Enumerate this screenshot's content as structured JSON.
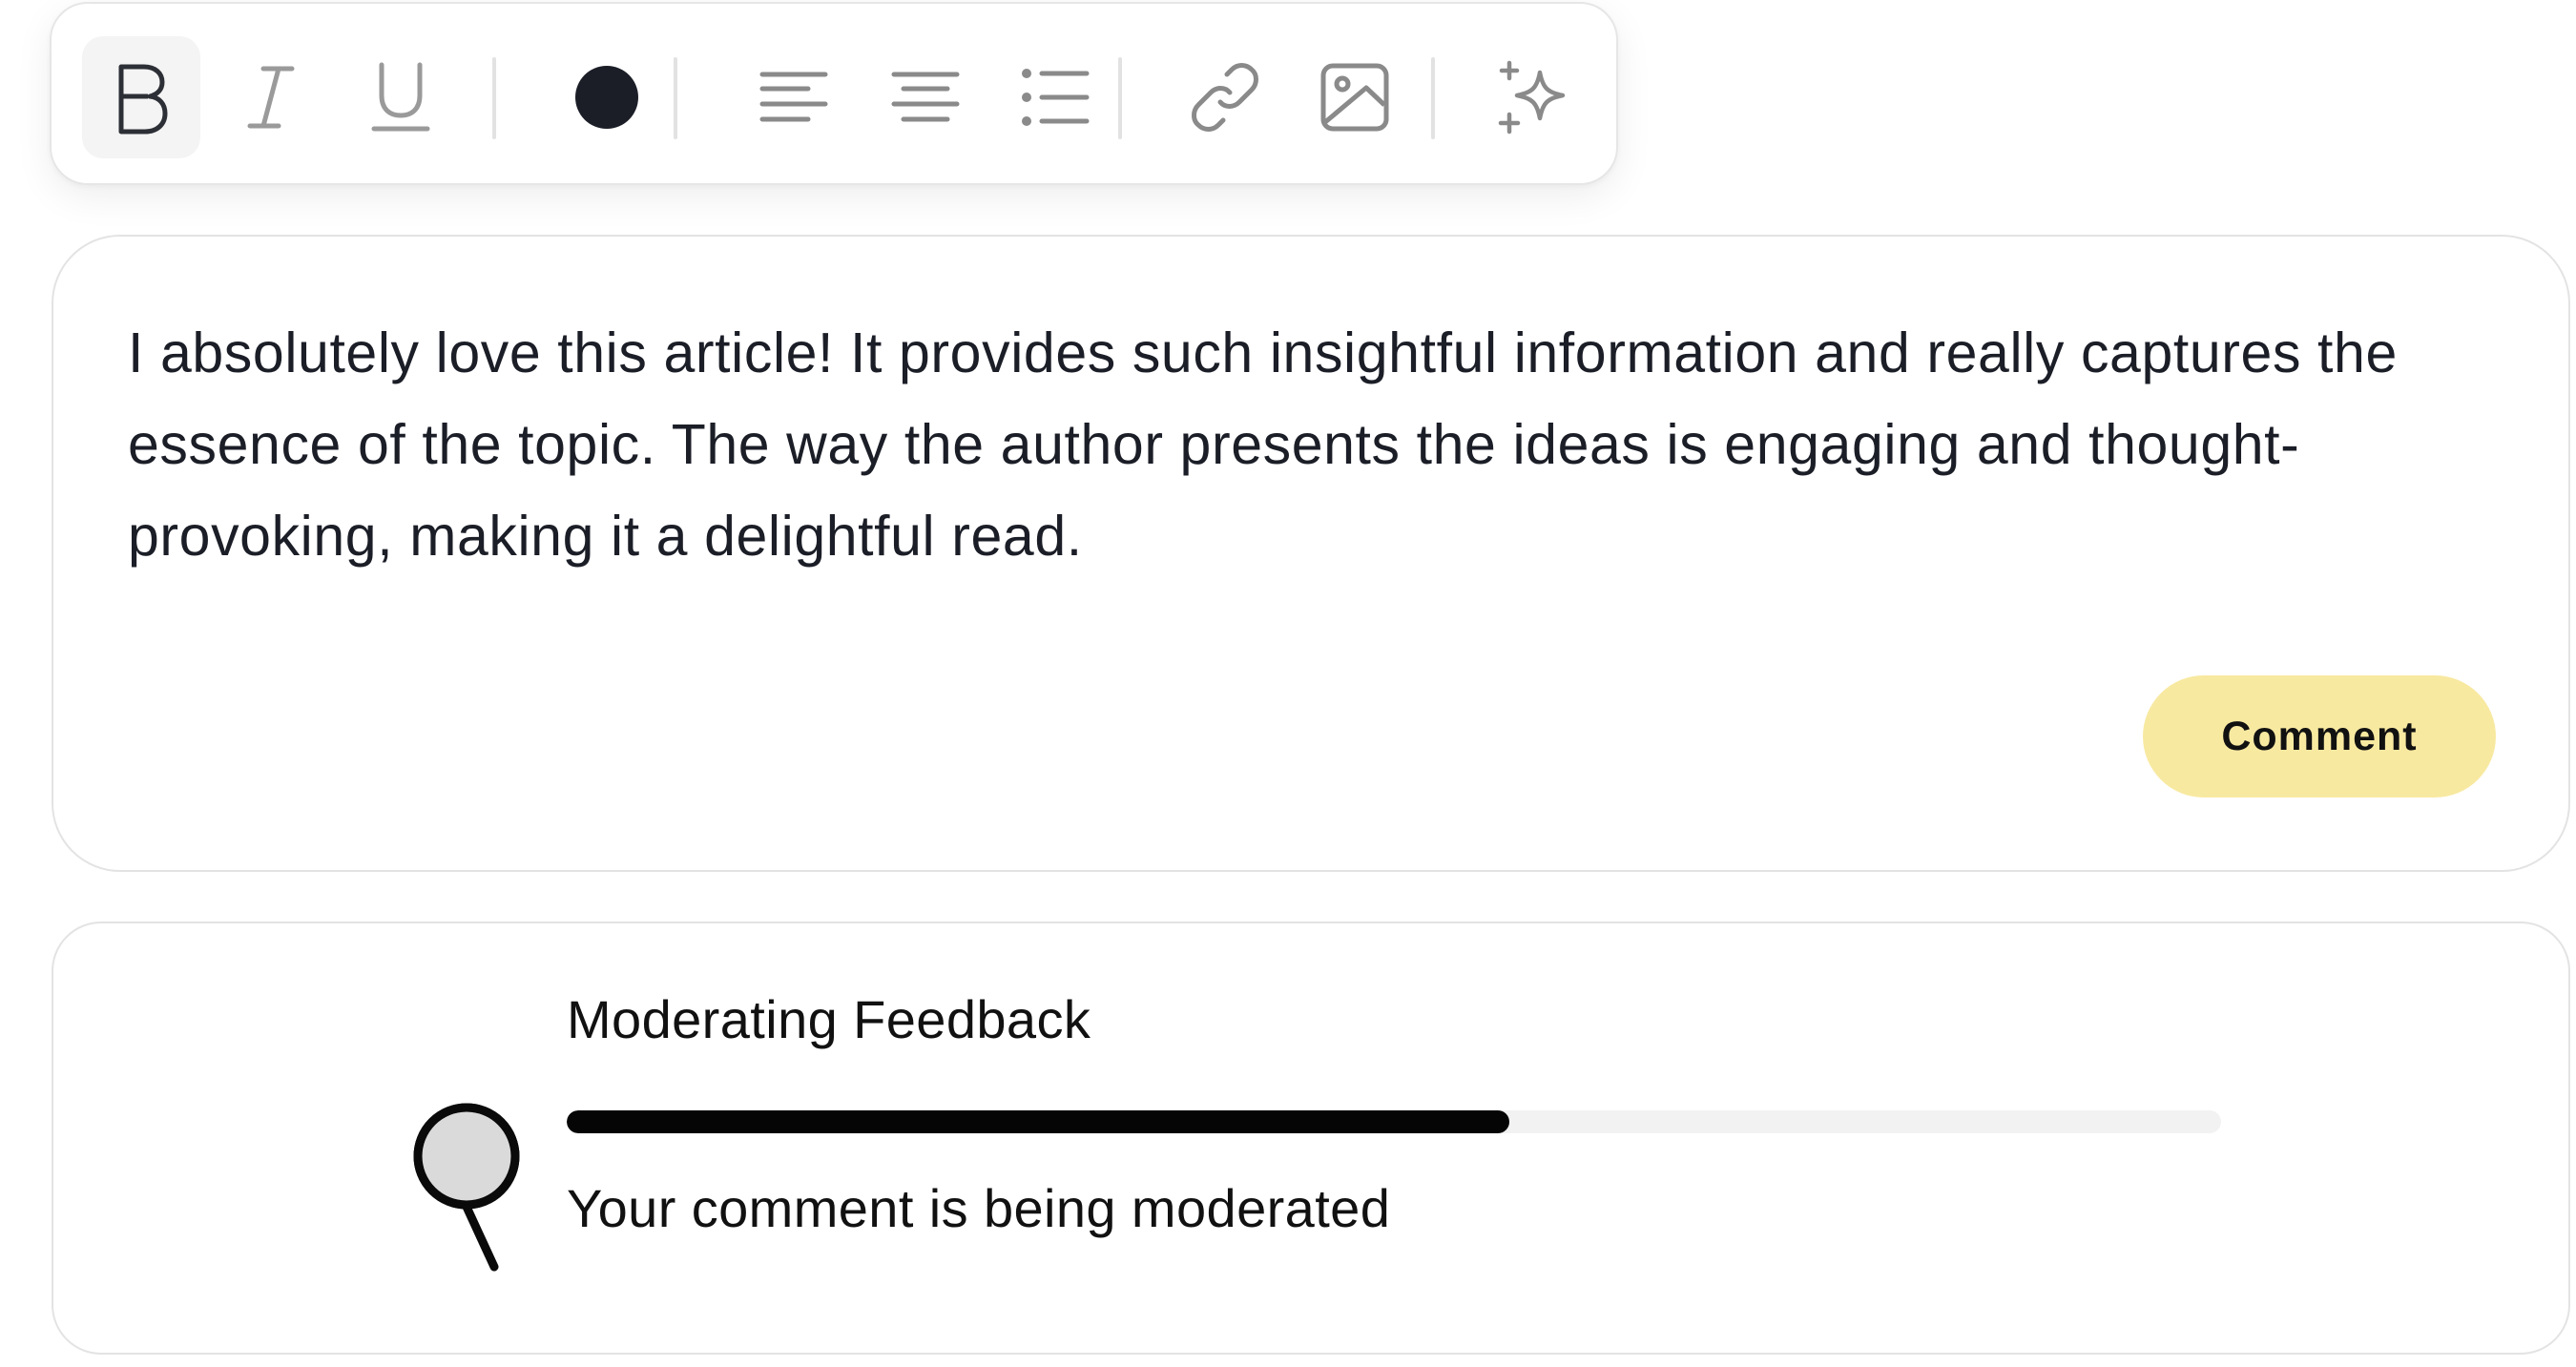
{
  "toolbar": {
    "items": [
      {
        "name": "bold-icon",
        "active": true
      },
      {
        "name": "italic-icon",
        "active": false
      },
      {
        "name": "underline-icon",
        "active": false
      },
      {
        "name": "text-color-icon",
        "color": "#1b1e27"
      },
      {
        "name": "align-left-icon"
      },
      {
        "name": "align-center-icon"
      },
      {
        "name": "bullet-list-icon"
      },
      {
        "name": "link-icon"
      },
      {
        "name": "image-icon"
      },
      {
        "name": "sparkles-icon"
      }
    ]
  },
  "editor": {
    "text": "I absolutely love this article! It provides such insightful information and really captures the essence of the topic. The way the author presents the ideas is engaging and thought-provoking, making it a delightful read.",
    "submit_label": "Comment",
    "submit_color": "#f8e9a1"
  },
  "moderation": {
    "title": "Moderating Feedback",
    "progress": 0.57,
    "status": "Your comment is being moderated",
    "illustration": "magnifier-search-icon"
  }
}
